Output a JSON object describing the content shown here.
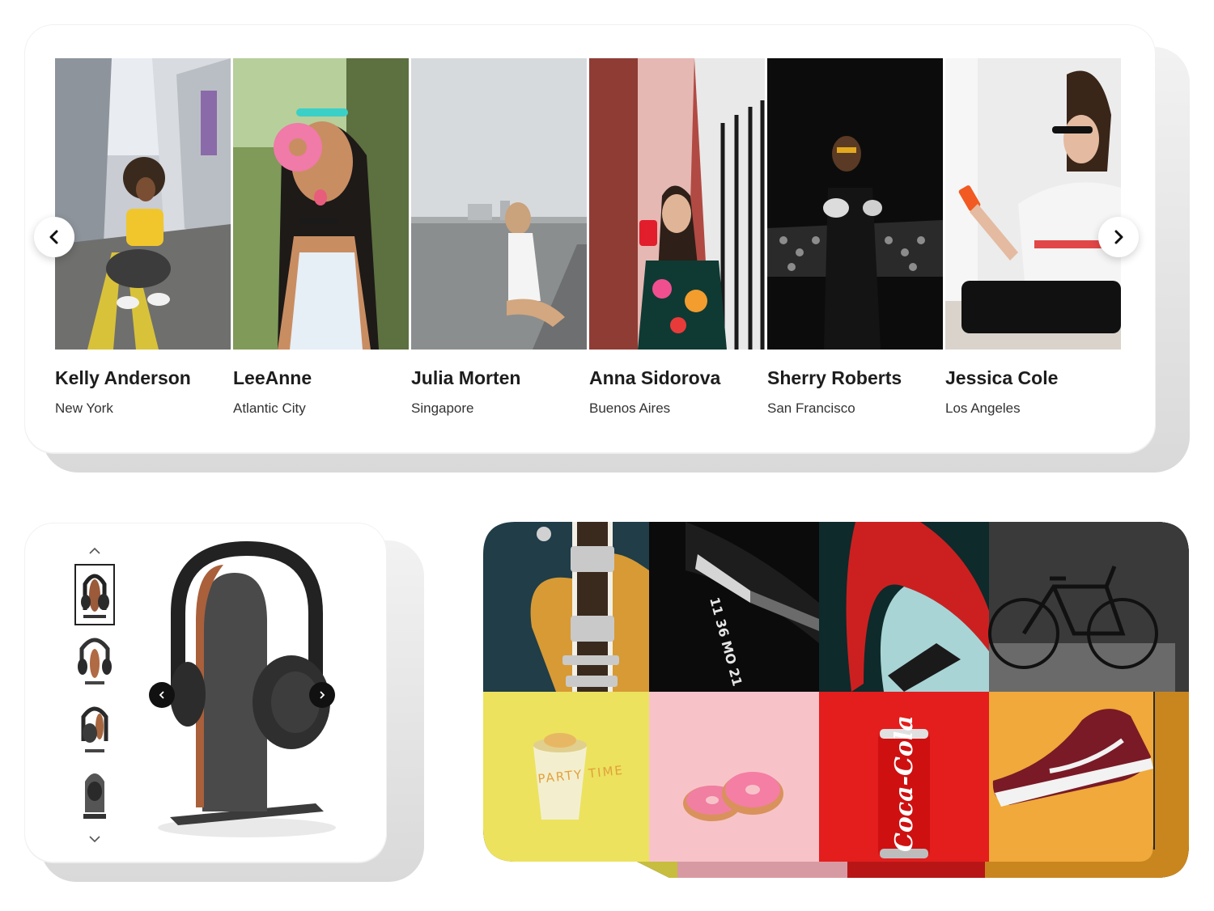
{
  "people_slider": {
    "people": [
      {
        "name": "Kelly Anderson",
        "city": "New York"
      },
      {
        "name": "LeeAnne",
        "city": "Atlantic City"
      },
      {
        "name": "Julia Morten",
        "city": "Singapore"
      },
      {
        "name": "Anna Sidorova",
        "city": "Buenos Aires"
      },
      {
        "name": "Sherry Roberts",
        "city": "San Francisco"
      },
      {
        "name": "Jessica Cole",
        "city": "Los Angeles"
      }
    ],
    "prev_icon": "chevron-left-icon",
    "next_icon": "chevron-right-icon"
  },
  "product_gallery": {
    "thumbnail_count": 4,
    "active_thumbnail": 1,
    "up_icon": "chevron-up-icon",
    "down_icon": "chevron-down-icon"
  },
  "mosaic": {
    "tiles": [
      {
        "subject": "guitar"
      },
      {
        "subject": "fitness-band",
        "text": "11 36 MO 21"
      },
      {
        "subject": "car"
      },
      {
        "subject": "bicycle"
      },
      {
        "subject": "cup",
        "text": "PARTY TIME"
      },
      {
        "subject": "donuts"
      },
      {
        "subject": "soda-can",
        "text": "Coca-Cola"
      },
      {
        "subject": "sneaker"
      }
    ]
  },
  "colors": {
    "slab_shadow": "#d9d9d9",
    "card_bg": "#ffffff",
    "button_dark": "#111111",
    "mosaic_yellow": "#ece25e",
    "mosaic_pink": "#f7c3c9",
    "mosaic_red": "#e41d1d",
    "mosaic_orange": "#f0a93a"
  }
}
